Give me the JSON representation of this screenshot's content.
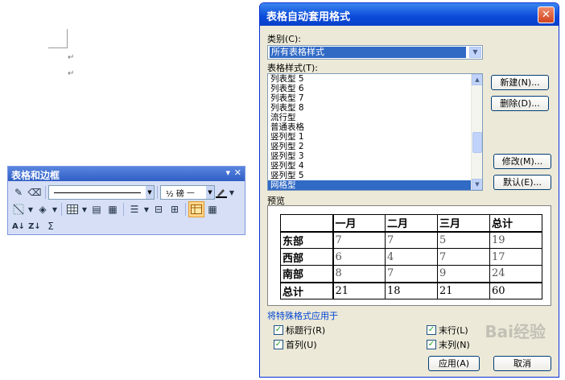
{
  "document": {
    "paragraph_mark": "↵"
  },
  "toolbar": {
    "title": "表格和边框",
    "line_weight": "½ 磅",
    "line_weight_dash": "—",
    "sum_symbol": "Σ"
  },
  "dialog": {
    "title": "表格自动套用格式",
    "category_label": "类别(C):",
    "category_value": "所有表格样式",
    "style_label": "表格样式(T):",
    "styles": [
      "列表型 5",
      "列表型 6",
      "列表型 7",
      "列表型 8",
      "流行型",
      "普通表格",
      "竖列型 1",
      "竖列型 2",
      "竖列型 3",
      "竖列型 4",
      "竖列型 5",
      "网格型"
    ],
    "selected_style": "网格型",
    "buttons": {
      "new": "新建(N)...",
      "delete": "删除(D)...",
      "modify": "修改(M)...",
      "default": "默认(E)...",
      "apply": "应用(A)",
      "cancel": "取消"
    },
    "preview_label": "预览",
    "preview_table": {
      "header": [
        "",
        "一月",
        "二月",
        "三月",
        "总计"
      ],
      "rows": [
        [
          "东部",
          "7",
          "7",
          "5",
          "19"
        ],
        [
          "西部",
          "6",
          "4",
          "7",
          "17"
        ],
        [
          "南部",
          "8",
          "7",
          "9",
          "24"
        ],
        [
          "总计",
          "21",
          "18",
          "21",
          "60"
        ]
      ]
    },
    "special_format_label": "将特殊格式应用于",
    "checkboxes": {
      "header_row": "标题行(R)",
      "first_column": "首列(U)",
      "last_row": "末行(L)",
      "last_column": "末列(N)"
    },
    "check_mark": "✓",
    "watermark": "Bai经验"
  },
  "colors": {
    "accent": "#316ac5",
    "titlebar": "#0a4ad9",
    "dialog_bg": "#ece9d8",
    "toolbar_bg": "#d6dff5"
  }
}
